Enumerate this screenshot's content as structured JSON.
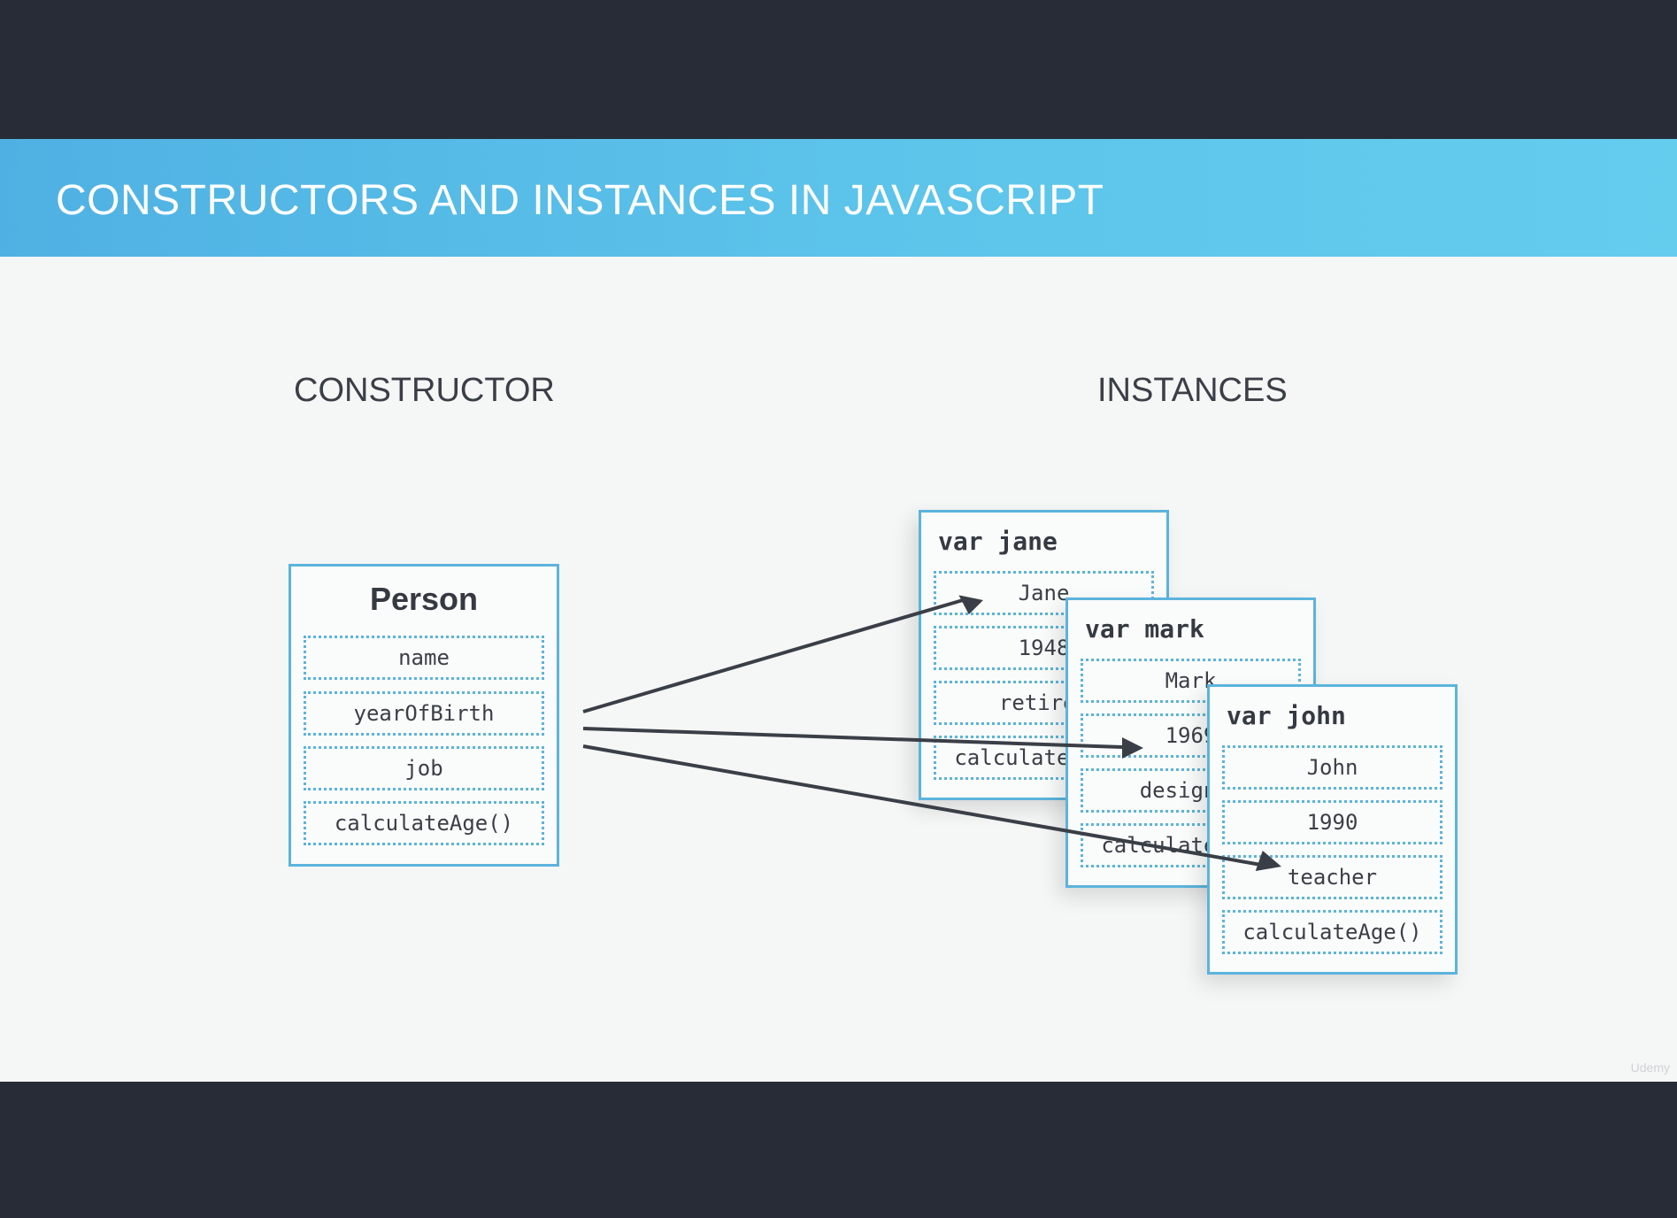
{
  "header": {
    "title": "CONSTRUCTORS AND INSTANCES IN JAVASCRIPT"
  },
  "constructor_heading": "CONSTRUCTOR",
  "instances_heading": "INSTANCES",
  "constructor": {
    "title": "Person",
    "fields": [
      "name",
      "yearOfBirth",
      "job",
      "calculateAge()"
    ]
  },
  "instances": [
    {
      "title": "var jane",
      "fields": [
        "Jane",
        "1948",
        "retired",
        "calculateAge()"
      ]
    },
    {
      "title": "var mark",
      "fields": [
        "Mark",
        "1969",
        "designer",
        "calculateAge()"
      ]
    },
    {
      "title": "var john",
      "fields": [
        "John",
        "1990",
        "teacher",
        "calculateAge()"
      ]
    }
  ],
  "watermark": "Udemy",
  "colors": {
    "banner": "#5cc3ea",
    "box_border": "#5bb4dc",
    "arrow": "#3a3f47",
    "frame": "#272c37"
  }
}
